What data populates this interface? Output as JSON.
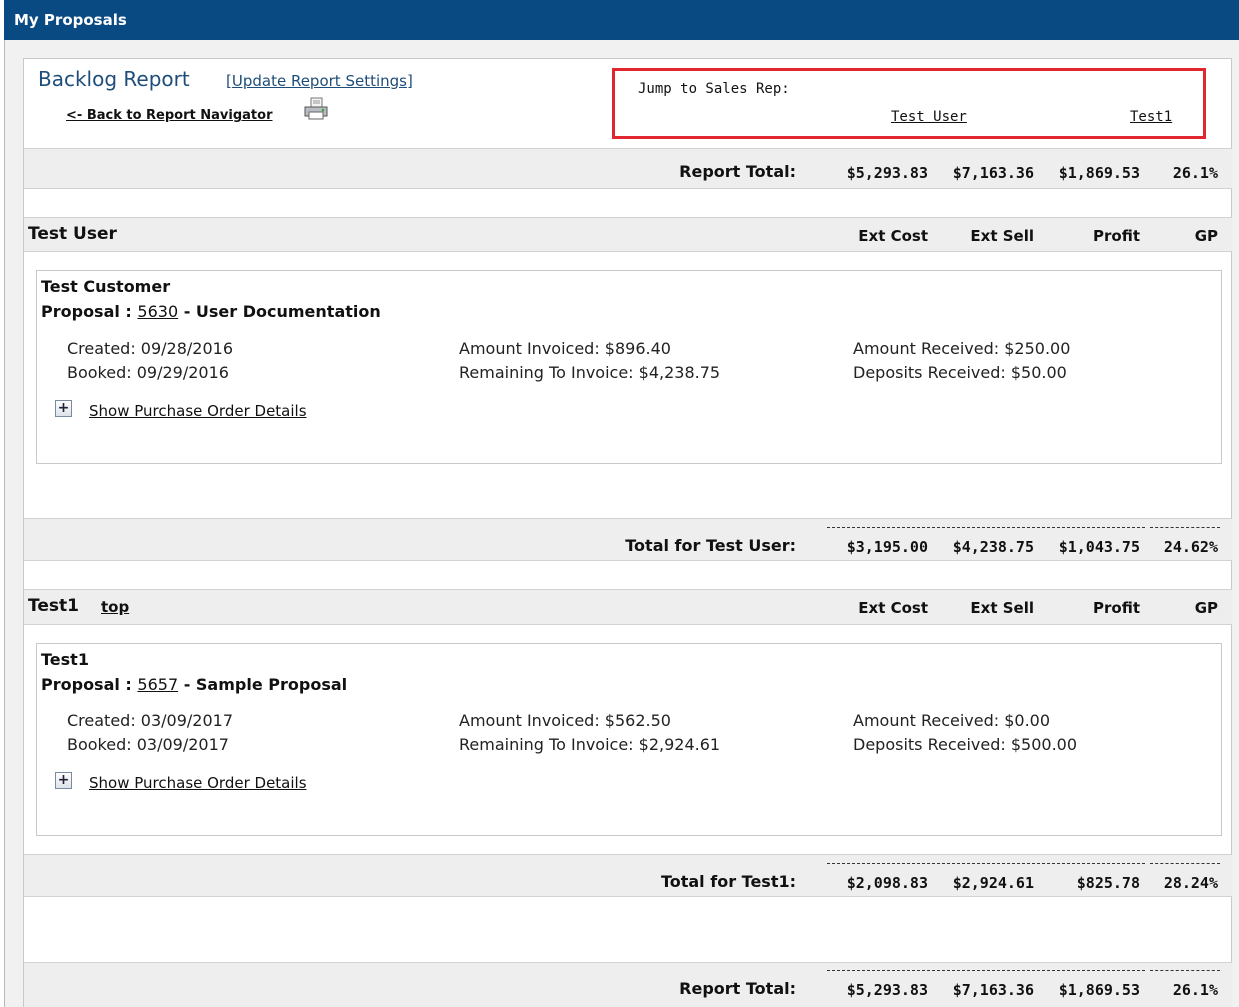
{
  "window": {
    "title": "My Proposals"
  },
  "header": {
    "report_title": "Backlog Report",
    "update_settings_open": "[",
    "update_settings_label": "Update Report Settings",
    "update_settings_close": "]",
    "back_link": "<- Back to Report Navigator",
    "print_icon": "printer-icon"
  },
  "jump": {
    "label": "Jump to Sales Rep:",
    "reps": [
      "Test User",
      "Test1"
    ],
    "highlight_color": "#e0262e"
  },
  "columns": {
    "ext_cost": "Ext Cost",
    "ext_sell": "Ext Sell",
    "profit": "Profit",
    "gp": "GP"
  },
  "report_total_top": {
    "label": "Report Total:",
    "ext_cost": "$5,293.83",
    "ext_sell": "$7,163.36",
    "profit": "$1,869.53",
    "gp": "26.1%"
  },
  "reps": [
    {
      "name": "Test User",
      "top_link": "",
      "customer": "Test Customer",
      "proposal_prefix": "Proposal : ",
      "proposal_number": "5630",
      "proposal_title": " - User Documentation",
      "created": "Created: 09/28/2016",
      "booked": "Booked: 09/29/2016",
      "amount_invoiced": "Amount Invoiced: $896.40",
      "remaining": "Remaining To Invoice: $4,238.75",
      "amount_received": "Amount Received: $250.00",
      "deposits": "Deposits Received: $50.00",
      "show_po": "Show Purchase Order Details",
      "total_label": "Total for Test User:",
      "ext_cost": "$3,195.00",
      "ext_sell": "$4,238.75",
      "profit": "$1,043.75",
      "gp": "24.62%"
    },
    {
      "name": "Test1",
      "top_link": "top",
      "customer": "Test1",
      "proposal_prefix": "Proposal : ",
      "proposal_number": "5657",
      "proposal_title": " - Sample Proposal",
      "created": "Created: 03/09/2017",
      "booked": "Booked: 03/09/2017",
      "amount_invoiced": "Amount Invoiced: $562.50",
      "remaining": "Remaining To Invoice: $2,924.61",
      "amount_received": "Amount Received: $0.00",
      "deposits": "Deposits Received: $500.00",
      "show_po": "Show Purchase Order Details",
      "total_label": "Total for Test1:",
      "ext_cost": "$2,098.83",
      "ext_sell": "$2,924.61",
      "profit": "$825.78",
      "gp": "28.24%"
    }
  ],
  "report_total_bottom": {
    "label": "Report Total:",
    "ext_cost": "$5,293.83",
    "ext_sell": "$7,163.36",
    "profit": "$1,869.53",
    "gp": "26.1%"
  },
  "colors": {
    "title_bar": "#0a4a83",
    "report_title": "#1f4d7a",
    "band": "#eeeeee"
  }
}
